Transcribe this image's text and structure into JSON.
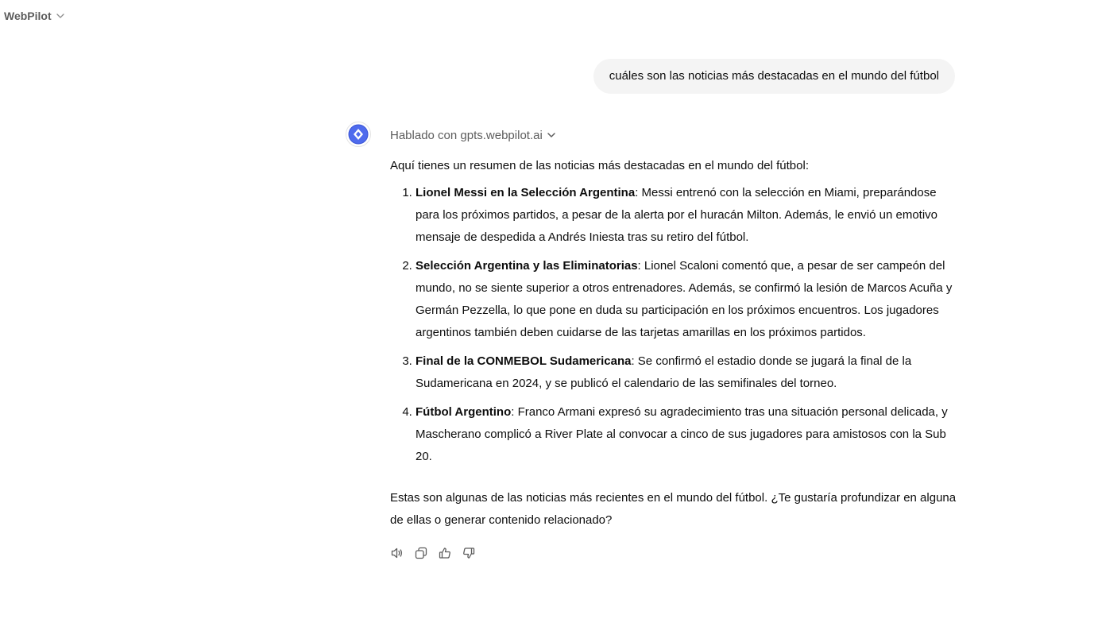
{
  "header": {
    "model_name": "WebPilot"
  },
  "user_message": {
    "text": "cuáles son las noticias más destacadas en el mundo del fútbol"
  },
  "assistant": {
    "tool_used": "Hablado con gpts.webpilot.ai",
    "intro": "Aquí tienes un resumen de las noticias más destacadas en el mundo del fútbol:",
    "items": [
      {
        "title": "Lionel Messi en la Selección Argentina",
        "body": ": Messi entrenó con la selección en Miami, preparándose para los próximos partidos, a pesar de la alerta por el huracán Milton. Además, le envió un emotivo mensaje de despedida a Andrés Iniesta tras su retiro del fútbol."
      },
      {
        "title": "Selección Argentina y las Eliminatorias",
        "body": ": Lionel Scaloni comentó que, a pesar de ser campeón del mundo, no se siente superior a otros entrenadores. Además, se confirmó la lesión de Marcos Acuña y Germán Pezzella, lo que pone en duda su participación en los próximos encuentros. Los jugadores argentinos también deben cuidarse de las tarjetas amarillas en los próximos partidos."
      },
      {
        "title": "Final de la CONMEBOL Sudamericana",
        "body": ": Se confirmó el estadio donde se jugará la final de la Sudamericana en 2024, y se publicó el calendario de las semifinales del torneo."
      },
      {
        "title": "Fútbol Argentino",
        "body": ": Franco Armani expresó su agradecimiento tras una situación personal delicada, y Mascherano complicó a River Plate al convocar a cinco de sus jugadores para amistosos con la Sub 20."
      }
    ],
    "closing": "Estas son algunas de las noticias más recientes en el mundo del fútbol. ¿Te gustaría profundizar en alguna de ellas o generar contenido relacionado?",
    "actions": [
      "speaker-icon",
      "copy-icon",
      "thumbs-up-icon",
      "thumbs-down-icon"
    ]
  },
  "colors": {
    "bubble_bg": "#f4f4f4",
    "muted_text": "#5d5d5d",
    "avatar_blue": "#4f6bed"
  }
}
